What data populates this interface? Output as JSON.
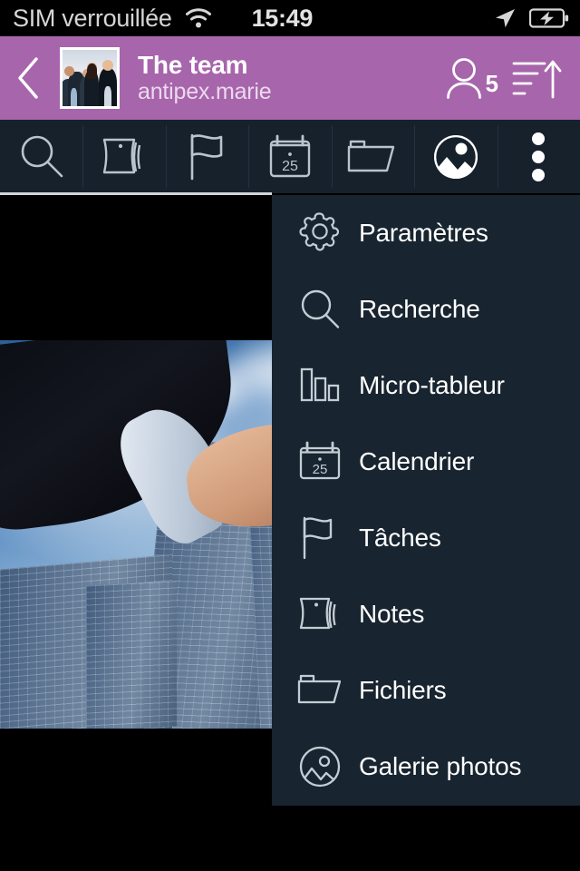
{
  "statusbar": {
    "carrier": "SIM verrouillée",
    "wifi_icon": "wifi-icon",
    "time": "15:49",
    "location_icon": "location-arrow-icon",
    "battery_icon": "battery-charging-icon"
  },
  "header": {
    "back_icon": "back-chevron-icon",
    "avatar_icon": "team-avatar-thumbnail",
    "title": "The team",
    "subtitle": "antipex.marie",
    "members_icon": "person-icon",
    "members_count": "5",
    "sort_icon": "sort-ascending-icon",
    "accent_color": "#a765ab"
  },
  "toolbar": {
    "background_color": "#16212c",
    "items": [
      {
        "name": "search",
        "icon": "search-icon",
        "active": false
      },
      {
        "name": "notes",
        "icon": "notes-icon",
        "active": false
      },
      {
        "name": "tasks",
        "icon": "flag-icon",
        "active": false
      },
      {
        "name": "calendar",
        "icon": "calendar-icon",
        "active": false,
        "day": "25"
      },
      {
        "name": "files",
        "icon": "folder-icon",
        "active": false
      },
      {
        "name": "gallery",
        "icon": "gallery-icon",
        "active": true
      },
      {
        "name": "more",
        "icon": "more-vertical-icon",
        "active": false
      }
    ]
  },
  "menu": {
    "background_color": "#18242f",
    "items": [
      {
        "label": "Paramètres",
        "icon": "gear-icon"
      },
      {
        "label": "Recherche",
        "icon": "search-icon"
      },
      {
        "label": "Micro-tableur",
        "icon": "bar-chart-icon"
      },
      {
        "label": "Calendrier",
        "icon": "calendar-icon",
        "day": "25"
      },
      {
        "label": "Tâches",
        "icon": "flag-icon"
      },
      {
        "label": "Notes",
        "icon": "notes-icon"
      },
      {
        "label": "Fichiers",
        "icon": "folder-icon"
      },
      {
        "label": "Galerie photos",
        "icon": "gallery-icon"
      }
    ]
  },
  "content": {
    "photo_alt": "handshake-over-skyscrapers-photo",
    "background_color": "#000000"
  }
}
